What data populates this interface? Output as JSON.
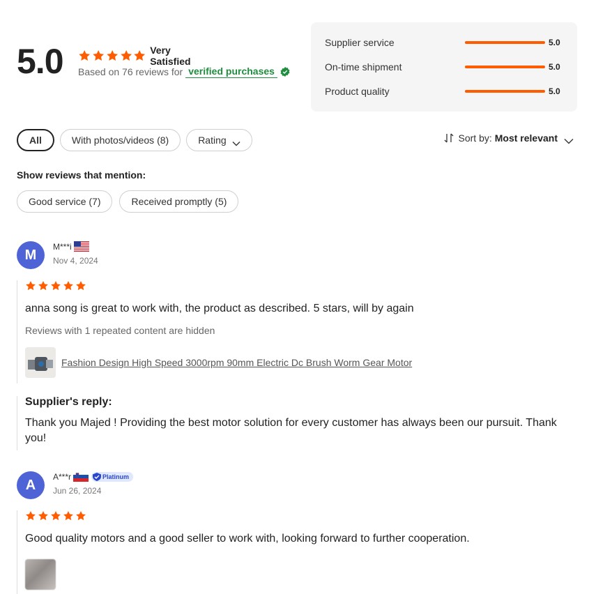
{
  "summary": {
    "score": "5.0",
    "satisfaction": "Very Satisfied",
    "based_on_prefix": "Based on 76 reviews for",
    "verified_label": "verified purchases",
    "star_color": "#ff5c00"
  },
  "metrics": [
    {
      "label": "Supplier service",
      "value": "5.0",
      "fraction": 1.0
    },
    {
      "label": "On-time shipment",
      "value": "5.0",
      "fraction": 1.0
    },
    {
      "label": "Product quality",
      "value": "5.0",
      "fraction": 1.0
    }
  ],
  "filters": {
    "all": "All",
    "photos": "With photos/videos (8)",
    "rating": "Rating"
  },
  "sort": {
    "label": "Sort by:",
    "value": "Most relevant"
  },
  "mentions": {
    "title": "Show reviews that mention:",
    "tags": [
      "Good service (7)",
      "Received promptly (5)"
    ]
  },
  "reviews": [
    {
      "initial": "M",
      "name": "M***i",
      "country_flag": "us-flag",
      "date": "Nov 4, 2024",
      "rating": 5,
      "text": "anna song is great to work with, the product as described. 5 stars, will by again",
      "hidden_note": "Reviews with 1 repeated content are hidden",
      "product": "Fashion Design High Speed 3000rpm 90mm Electric Dc Brush Worm Gear Motor",
      "reply_title": "Supplier's reply:",
      "reply_text": "Thank you Majed ! Providing the best motor solution for every customer has always been our pursuit. Thank you!"
    },
    {
      "initial": "A",
      "name": "A***r",
      "country_flag": "slovenia-flag",
      "badge": "Platinum",
      "date": "Jun 26, 2024",
      "rating": 5,
      "text": "Good quality motors and a good seller to work with, looking forward to further cooperation."
    }
  ]
}
